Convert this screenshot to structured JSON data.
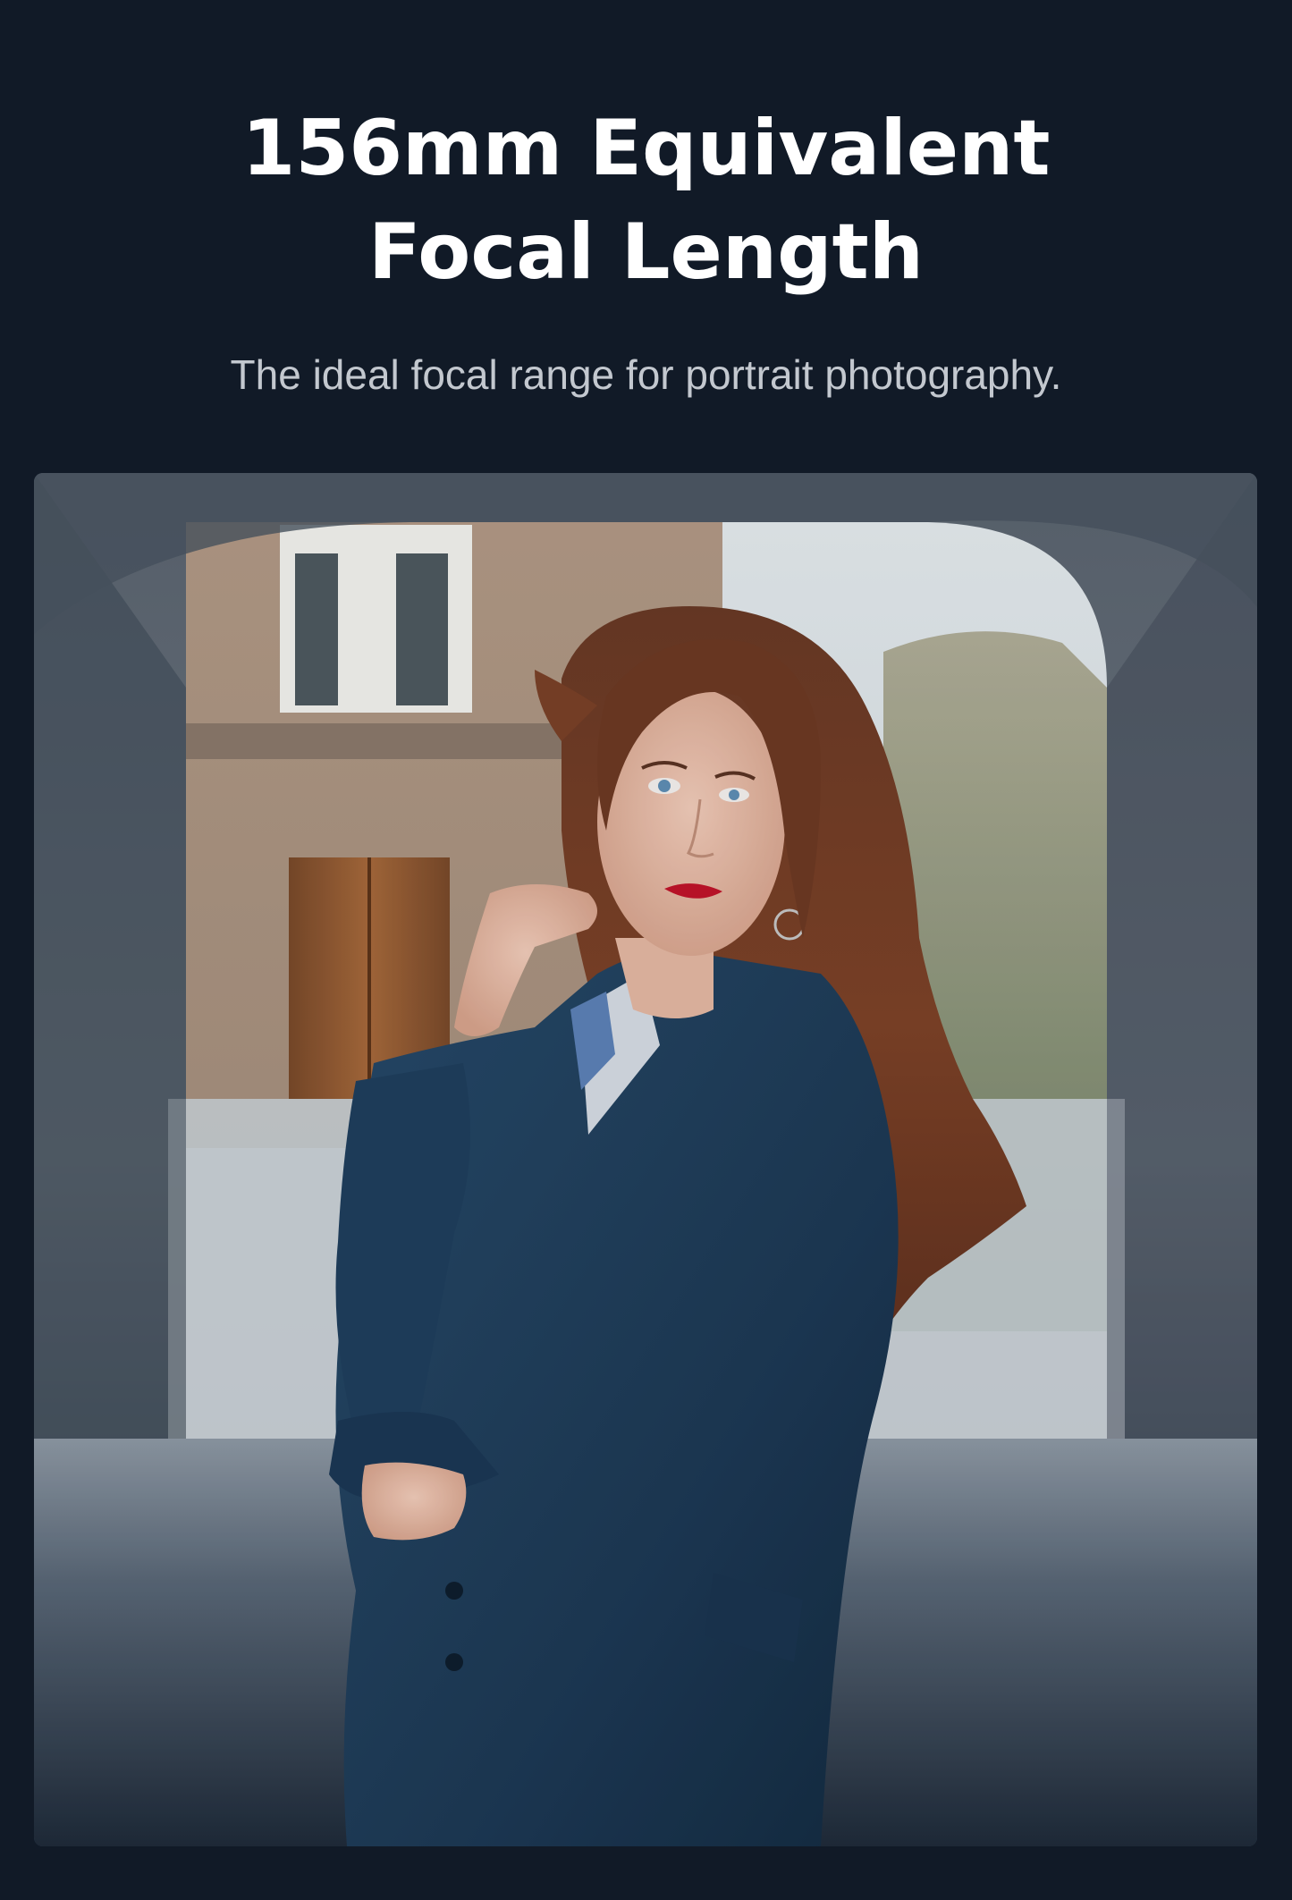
{
  "heading": {
    "line1": "156mm Equivalent",
    "line2": "Focal Length"
  },
  "subtitle": "The ideal focal range for portrait photography.",
  "photo": {
    "icon": "portrait-photo"
  },
  "colors": {
    "background": "#111a27",
    "heading": "#ffffff",
    "subtitle": "#c3c8cf"
  }
}
